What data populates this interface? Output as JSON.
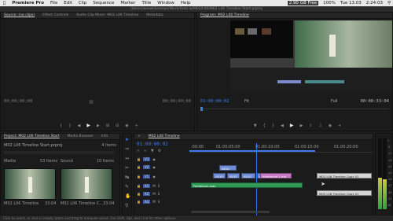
{
  "menubar": {
    "apple": "",
    "app": "Premiere Pro",
    "items": [
      "File",
      "Edit",
      "Clip",
      "Sequence",
      "Marker",
      "Title",
      "Window",
      "Help"
    ],
    "free": "2.90 GB Free",
    "battery": "100%",
    "time": "Tue 13.03",
    "clock": "2:24:03"
  },
  "titlebar": "/Users/weswilliamson/Work/Auto.io/M02/L06/M02 L06 Timeline Start.prproj",
  "source": {
    "tabs": [
      "Source: (no clips)",
      "Effect Controls",
      "Audio Clip Mixer: M02 L06 Timeline",
      "Metadata"
    ],
    "tc_left": "00;00;00;00",
    "tc_right": "00;00;00;00"
  },
  "program": {
    "tab": "Program: M02 L06 Timeline",
    "tc_left": "01:00:00:02",
    "fit": "Fit",
    "quality": "Full",
    "tc_right": "00:00:33:04"
  },
  "project": {
    "tabs": [
      "Project: M02 L06 Timeline Start",
      "Media Browser",
      "Info"
    ],
    "file": "M02 L06 Timeline Start.prproj",
    "count": "4 Items",
    "bins": [
      {
        "name": "Media",
        "items": "53 Items"
      },
      {
        "name": "Sound",
        "items": "10 Items"
      }
    ],
    "thumbs": [
      {
        "label": "M02 L06 Timeline",
        "dur": "33:04"
      },
      {
        "label": "M02 L06 Timeline C...",
        "dur": "33:04"
      }
    ]
  },
  "timeline": {
    "tab": "M02 L06 Timeline",
    "tc": "01:00:00:02",
    "ruler": [
      ":00:00",
      "01:00:05:00",
      "01:00:10:00",
      "01:00:15:00",
      "01:00:20:00"
    ],
    "tracks": [
      {
        "id": "V3"
      },
      {
        "id": "V2"
      },
      {
        "id": "V1"
      },
      {
        "id": "A1"
      },
      {
        "id": "A2"
      },
      {
        "id": "A3"
      }
    ],
    "clips": [
      {
        "text": "A010"
      },
      {
        "text": "A010"
      },
      {
        "text": "A010"
      },
      {
        "text": "A010"
      },
      {
        "text": "A016"
      },
      {
        "text": "A018"
      },
      {
        "text": "Interlaced 1.mo"
      },
      {
        "text": "Feelbloom.wav"
      },
      {
        "text": "M02 L06 Timeline Copy 01"
      },
      {
        "text": "M02 L06 Timeline Copy 01"
      }
    ],
    "meter": [
      "0",
      "-6",
      "-12",
      "-18",
      "-24",
      "-30",
      "-36",
      "-42",
      "-48",
      "-54",
      "dB"
    ]
  },
  "status": "Click to select, or click in empty space and drag to marquee select. Use Shift, Opt, and Cmd for other options."
}
